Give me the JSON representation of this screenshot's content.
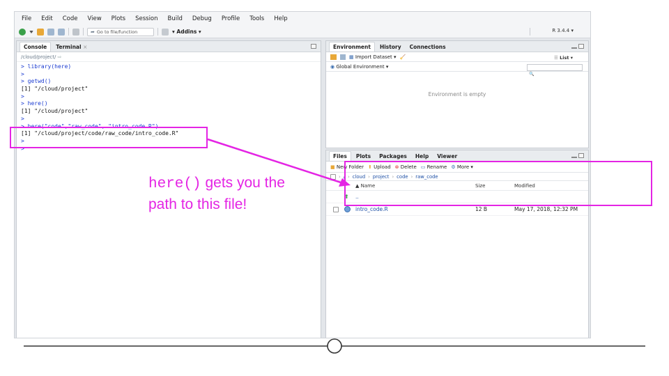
{
  "menu": [
    "File",
    "Edit",
    "Code",
    "View",
    "Plots",
    "Session",
    "Build",
    "Debug",
    "Profile",
    "Tools",
    "Help"
  ],
  "toolbar": {
    "goto_placeholder": "Go to file/function",
    "addins_label": "Addins",
    "r_version": "R 3.4.4"
  },
  "console": {
    "tabs": [
      "Console",
      "Terminal"
    ],
    "path": "/cloud/project/",
    "lines": [
      {
        "kind": "in",
        "text": "> library(here)"
      },
      {
        "kind": "in",
        "text": ">"
      },
      {
        "kind": "in",
        "text": "> getwd()"
      },
      {
        "kind": "out",
        "text": "[1] \"/cloud/project\""
      },
      {
        "kind": "in",
        "text": ">"
      },
      {
        "kind": "in",
        "text": "> here()"
      },
      {
        "kind": "out",
        "text": "[1] \"/cloud/project\""
      },
      {
        "kind": "in",
        "text": ">"
      },
      {
        "kind": "in",
        "text": "> here(\"code\",\"raw_code\", \"intro_code.R\")"
      },
      {
        "kind": "out",
        "text": "[1] \"/cloud/project/code/raw_code/intro_code.R\""
      },
      {
        "kind": "in",
        "text": ">"
      },
      {
        "kind": "in",
        "text": ">"
      }
    ]
  },
  "environment": {
    "tabs": [
      "Environment",
      "History",
      "Connections"
    ],
    "import_label": "Import Dataset",
    "list_label": "List",
    "scope_label": "Global Environment",
    "empty_text": "Environment is empty"
  },
  "files": {
    "tabs": [
      "Files",
      "Plots",
      "Packages",
      "Help",
      "Viewer"
    ],
    "actions": [
      "New Folder",
      "Upload",
      "Delete",
      "Rename",
      "More"
    ],
    "breadcrumb": [
      "cloud",
      "project",
      "code",
      "raw_code"
    ],
    "columns": {
      "name": "Name",
      "size": "Size",
      "modified": "Modified"
    },
    "up_label": "..",
    "rows": [
      {
        "name": "intro_code.R",
        "size": "12 B",
        "modified": "May 17, 2018, 12:32 PM"
      }
    ]
  },
  "annotation": {
    "code": "here()",
    "text1": " gets you the",
    "text2": "path to this file!"
  },
  "colors": {
    "highlight": "#e424e4",
    "link": "#1d4fa5",
    "console_input": "#1a3bd1"
  },
  "progress": 0.5
}
